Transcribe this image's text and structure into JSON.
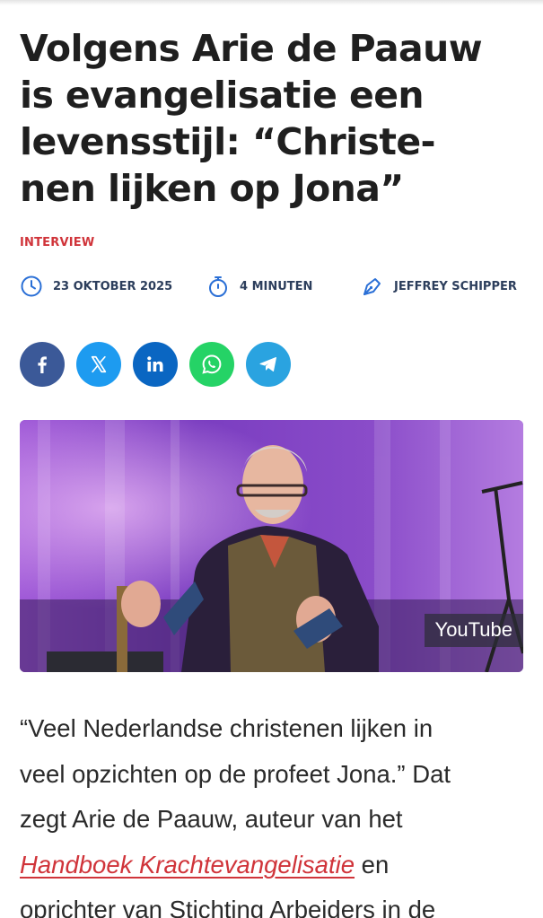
{
  "article": {
    "title_lines": [
      "Volgens Arie de Paauw",
      "is evangelisatie een",
      "levensstijl: “Christe-",
      "nen lijken op Jona”"
    ],
    "category": "INTERVIEW",
    "date": "23 OKTOBER 2025",
    "reading_time": "4 MINUTEN",
    "author": "JEFFREY SCHIPPER"
  },
  "share": {
    "buttons": [
      {
        "name": "facebook",
        "glyph": "f",
        "color": "#3b5998"
      },
      {
        "name": "x",
        "glyph": "𝕏",
        "color": "#1d9bf0"
      },
      {
        "name": "linkedin",
        "glyph": "in",
        "color": "#0a66c2"
      },
      {
        "name": "whatsapp",
        "glyph": "whatsapp-icon",
        "color": "#25d366"
      },
      {
        "name": "telegram",
        "glyph": "telegram-icon",
        "color": "#2aa3e0"
      }
    ]
  },
  "hero": {
    "badge": "YouTube"
  },
  "body": {
    "line1": "“Veel Nederlandse christenen lijken in",
    "line2": "veel opzichten op de profeet Jona.” Dat",
    "line3": "zegt Arie de Paauw, auteur van het",
    "link": "Handboek Krachtevangelisatie",
    "line4_after": " en",
    "line5": "oprichter van Stichting Arbeiders in de"
  },
  "colors": {
    "accent": "#d0343a",
    "meta": "#2c3e5c",
    "icon_blue": "#2a6fd6"
  }
}
